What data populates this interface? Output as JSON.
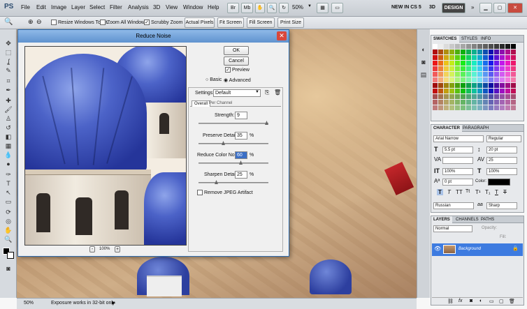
{
  "menubar": {
    "logo": "PS",
    "items": [
      "File",
      "Edit",
      "Image",
      "Layer",
      "Select",
      "Filter",
      "Analysis",
      "3D",
      "View",
      "Window",
      "Help"
    ],
    "zoom": "50%",
    "new_in": "NEW IN CS 5",
    "three_d": "3D",
    "design": "DESIGN"
  },
  "options_bar": {
    "resize_windows": "Resize Windows To Fit",
    "zoom_all": "Zoom All Windows",
    "scrubby_zoom": "Scrubby Zoom",
    "actual_pixels": "Actual Pixels",
    "fit_screen": "Fit Screen",
    "fill_screen": "Fill Screen",
    "print_size": "Print Size"
  },
  "dialog": {
    "title": "Reduce Noise",
    "ok": "OK",
    "cancel": "Cancel",
    "preview": "Preview",
    "basic": "Basic",
    "advanced": "Advanced",
    "settings_label": "Settings:",
    "settings_value": "Default",
    "tab_overall": "Overall",
    "tab_per_channel": "Per Channel",
    "strength_label": "Strength:",
    "strength_value": "9",
    "preserve_label": "Preserve Details:",
    "preserve_value": "35",
    "reduce_color_label": "Reduce Color Noise:",
    "reduce_color_value": "60",
    "sharpen_label": "Sharpen Details:",
    "sharpen_value": "25",
    "percent": "%",
    "jpeg_label": "Remove JPEG Artifact",
    "zoom_value": "100%",
    "zoom_minus": "-",
    "zoom_plus": "+"
  },
  "status": {
    "zoom": "50%",
    "message": "Exposure works in 32-bit only"
  },
  "swatches": {
    "tabs": [
      "SWATCHES",
      "STYLES",
      "INFO"
    ]
  },
  "character": {
    "tabs": [
      "CHARACTER",
      "PARAGRAPH"
    ],
    "font_family": "Arial Narrow",
    "font_style": "Regular",
    "font_size": "5.5 pt",
    "leading": "20 pt",
    "tracking": "25",
    "vscale": "100%",
    "hscale": "100%",
    "baseline": "0 pt",
    "color_label": "Color:",
    "language": "Russian",
    "aa_label": "aa",
    "antialias": "Sharp"
  },
  "layers": {
    "tabs": [
      "LAYERS",
      "CHANNELS",
      "PATHS"
    ],
    "blend_mode": "Normal",
    "opacity_label": "Opacity:",
    "fill_label": "Fill:",
    "layer_name": "Background"
  }
}
